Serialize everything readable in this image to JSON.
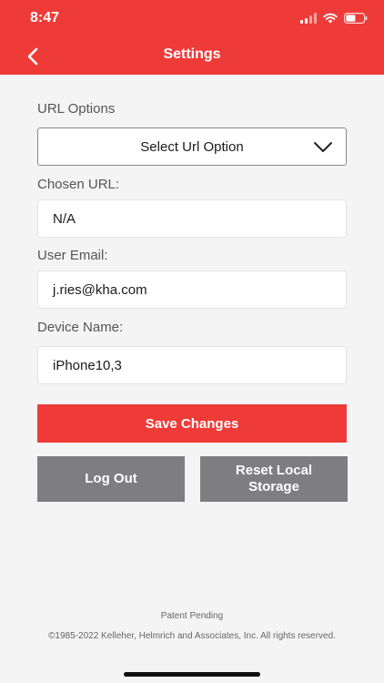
{
  "status_bar": {
    "time": "8:47",
    "icons": [
      "cellular-signal-icon",
      "wifi-icon",
      "battery-icon"
    ]
  },
  "nav": {
    "title": "Settings",
    "back_icon": "chevron-left-icon"
  },
  "form": {
    "url_options_label": "URL Options",
    "url_select_value": "Select Url Option",
    "chosen_url_label": "Chosen URL:",
    "chosen_url_value": "N/A",
    "user_email_label": "User Email:",
    "user_email_value": "j.ries@kha.com",
    "device_name_label": "Device Name:",
    "device_name_value": "iPhone10,3"
  },
  "actions": {
    "save_label": "Save Changes",
    "logout_label": "Log Out",
    "reset_label": "Reset Local Storage"
  },
  "footer": {
    "patent": "Patent Pending",
    "copyright": "©1985-2022 Kelleher, Helmrich and Associates, Inc. All rights reserved."
  },
  "colors": {
    "brand_red": "#ef3b38",
    "button_gray": "#7e7e80",
    "background": "#f4f4f4"
  }
}
